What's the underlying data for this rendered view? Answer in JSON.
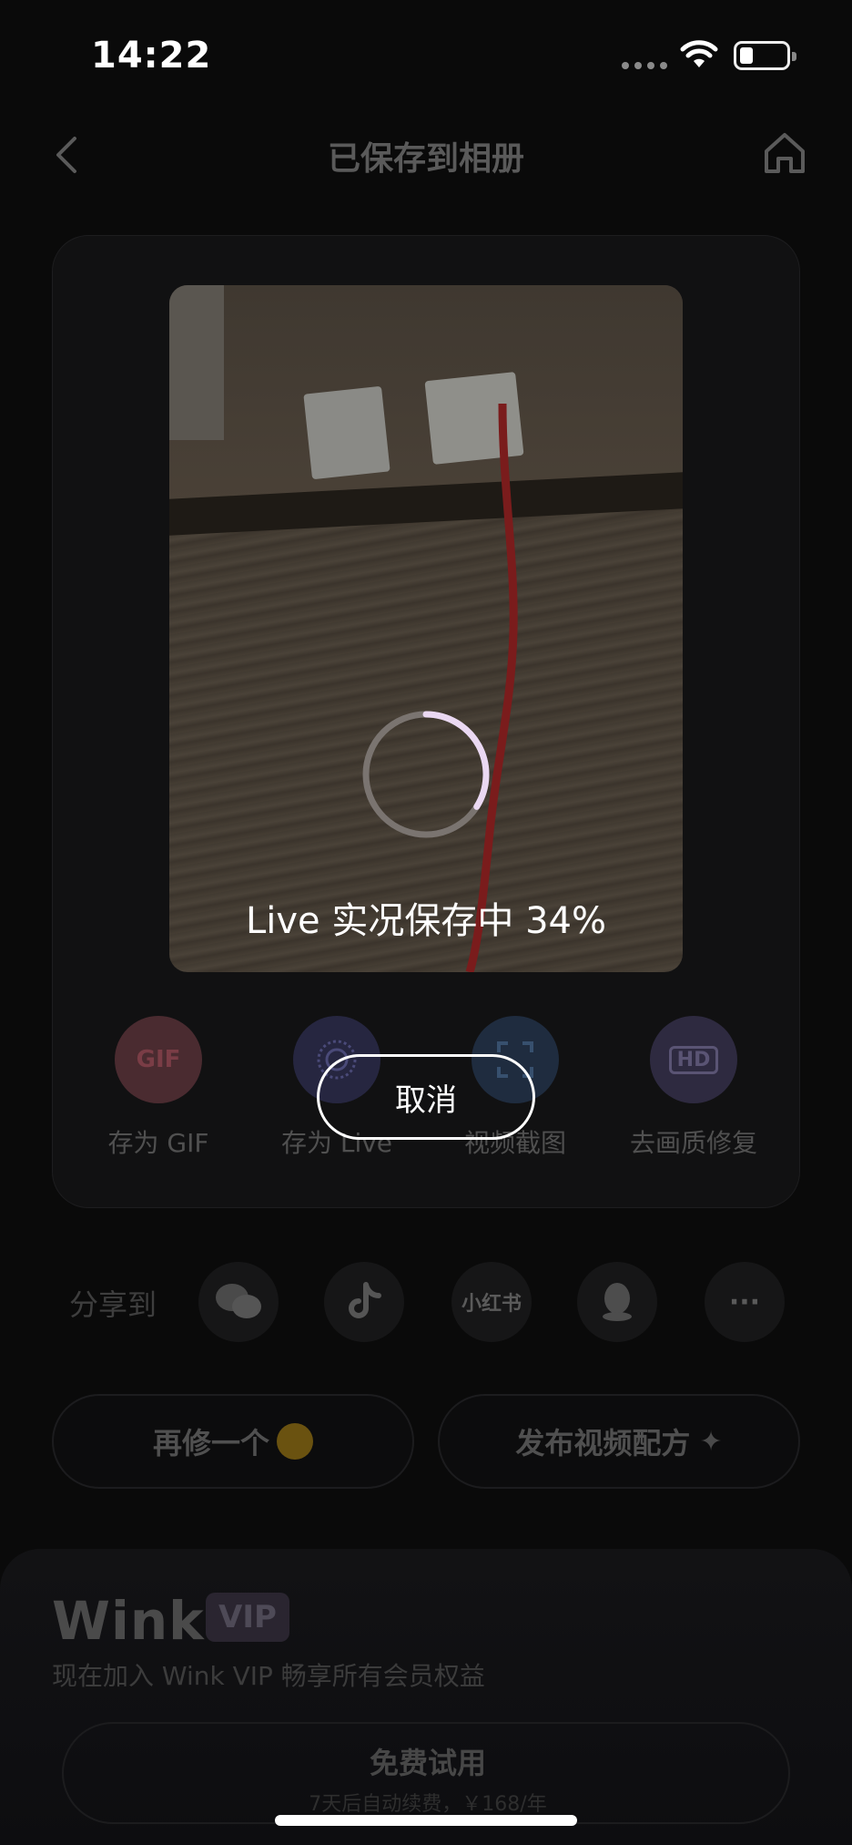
{
  "status_bar": {
    "time": "14:22"
  },
  "nav": {
    "title": "已保存到相册"
  },
  "media": {
    "progress_text": "Live 实况保存中 34%",
    "progress": 0.34,
    "cancel_label": "取消"
  },
  "actions": [
    {
      "label": "存为 GIF",
      "icon_text": "GIF",
      "icon": "gif-icon",
      "color": "#4a2b30"
    },
    {
      "label": "存为 Live",
      "icon_text": "",
      "icon": "live-photo-icon",
      "color": "#262640"
    },
    {
      "label": "视频截图",
      "icon_text": "",
      "icon": "screenshot-icon",
      "color": "#1f2c3f"
    },
    {
      "label": "去画质修复",
      "icon_text": "HD",
      "icon": "hd-icon",
      "color": "#2e2a40"
    }
  ],
  "share": {
    "label": "分享到",
    "targets": [
      {
        "icon": "wechat-icon",
        "text": ""
      },
      {
        "icon": "douyin-icon",
        "text": ""
      },
      {
        "icon": "xiaohongshu-icon",
        "text": "小红书"
      },
      {
        "icon": "qq-icon",
        "text": ""
      },
      {
        "icon": "more-icon",
        "text": "···"
      }
    ]
  },
  "buttons": {
    "retouch": "再修一个",
    "publish": "发布视频配方"
  },
  "vip": {
    "logo": "Wink",
    "badge": "VIP",
    "description": "现在加入 Wink VIP 畅享所有会员权益",
    "trial_label": "免费试用",
    "trial_note": "7天后自动续费，￥168/年"
  }
}
